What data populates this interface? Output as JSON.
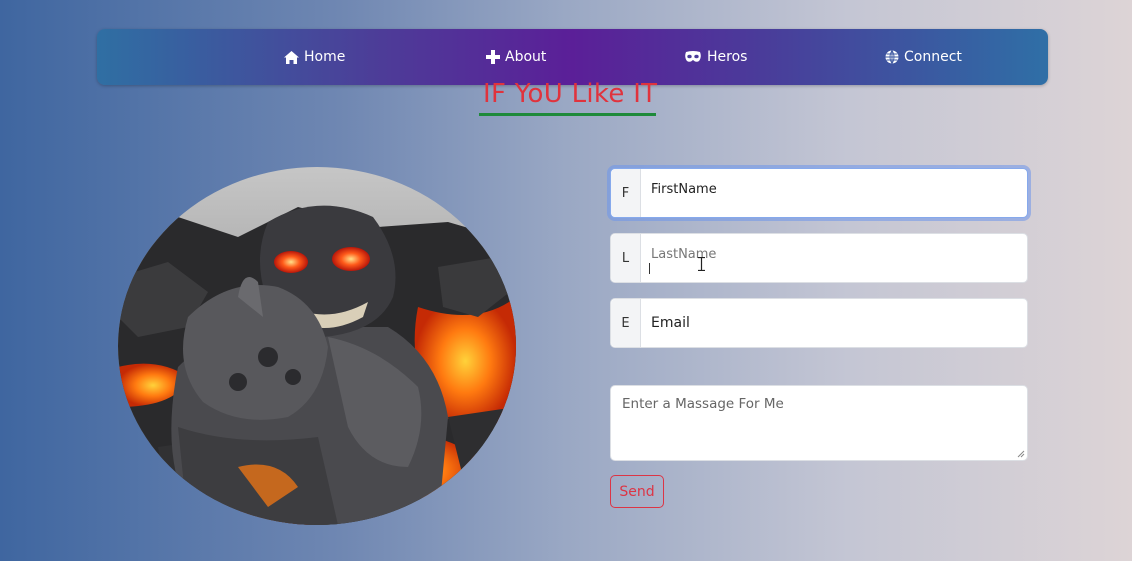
{
  "nav": {
    "items": [
      {
        "label": "Home",
        "icon": "house-icon"
      },
      {
        "label": "About",
        "icon": "plus-icon"
      },
      {
        "label": "Heros",
        "icon": "mask-icon"
      },
      {
        "label": "Connect",
        "icon": "globe-icon"
      }
    ]
  },
  "heading": {
    "text": "IF YoU Like IT",
    "color": "#e0333d",
    "underline_color": "#1e8a3a"
  },
  "form": {
    "first": {
      "prefix": "F",
      "value": "FirstName"
    },
    "last": {
      "prefix": "L",
      "placeholder": "LastName"
    },
    "email": {
      "prefix": "E",
      "value": "Email"
    },
    "message": {
      "placeholder": "Enter a Massage For Me"
    },
    "send_label": "Send"
  },
  "colors": {
    "send": "#dc3545",
    "focus_ring": "#86a9ec"
  }
}
